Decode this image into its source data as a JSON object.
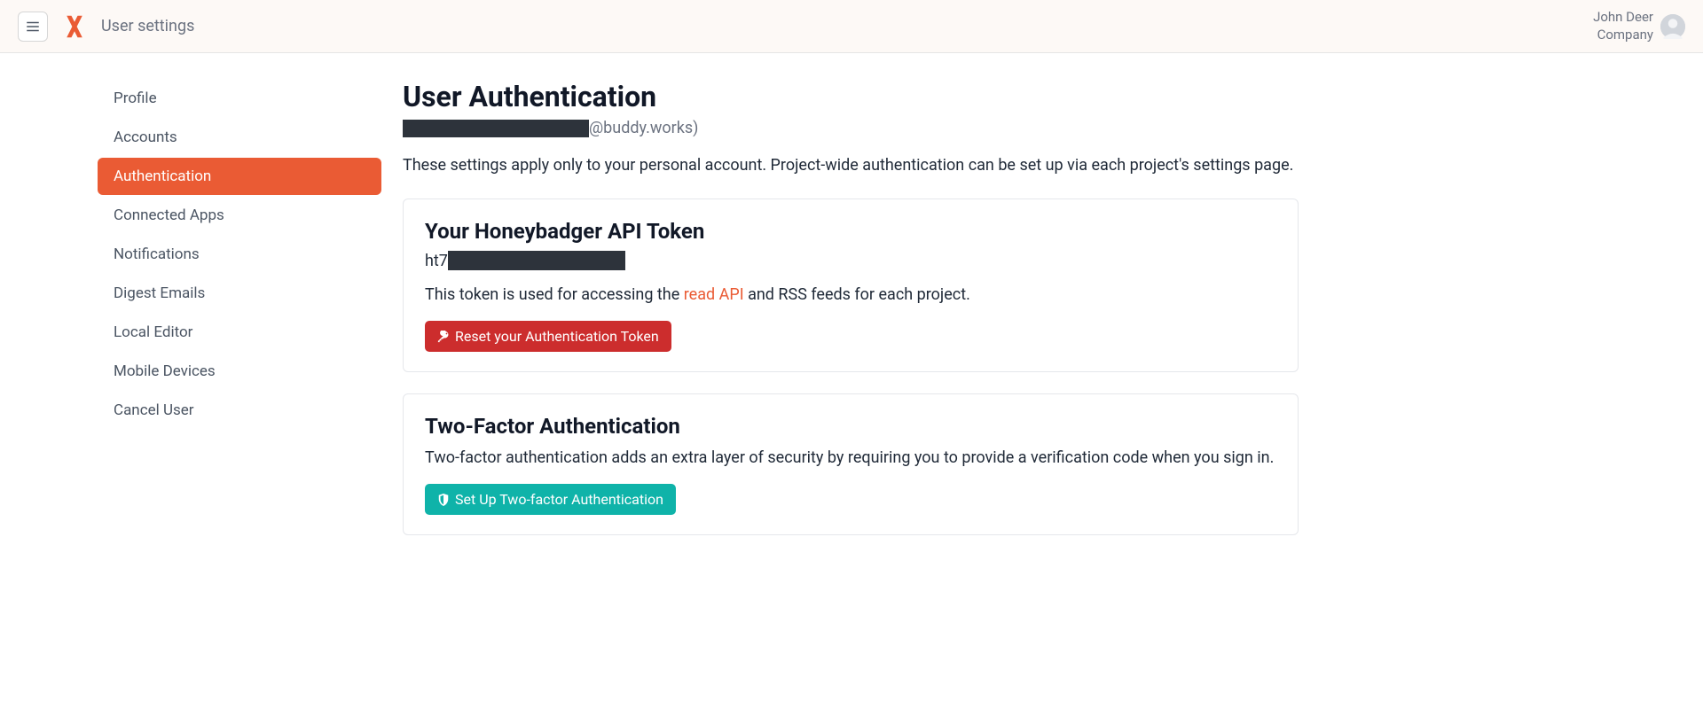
{
  "header": {
    "page_title": "User settings",
    "user_name": "John Deer",
    "company_name": "Company"
  },
  "sidebar": {
    "items": [
      {
        "label": "Profile",
        "active": false
      },
      {
        "label": "Accounts",
        "active": false
      },
      {
        "label": "Authentication",
        "active": true
      },
      {
        "label": "Connected Apps",
        "active": false
      },
      {
        "label": "Notifications",
        "active": false
      },
      {
        "label": "Digest Emails",
        "active": false
      },
      {
        "label": "Local Editor",
        "active": false
      },
      {
        "label": "Mobile Devices",
        "active": false
      },
      {
        "label": "Cancel User",
        "active": false
      }
    ]
  },
  "content": {
    "title": "User Authentication",
    "email_domain": "@buddy.works)",
    "description": "These settings apply only to your personal account. Project-wide authentication can be set up via each project's settings page.",
    "api_token": {
      "title": "Your Honeybadger API Token",
      "prefix": "ht7",
      "desc_before": "This token is used for accessing the ",
      "link_text": "read API",
      "desc_after": " and RSS feeds for each project.",
      "reset_button": "Reset your Authentication Token"
    },
    "two_factor": {
      "title": "Two-Factor Authentication",
      "description": "Two-factor authentication adds an extra layer of security by requiring you to provide a verification code when you sign in.",
      "setup_button": "Set Up Two-factor Authentication"
    }
  }
}
